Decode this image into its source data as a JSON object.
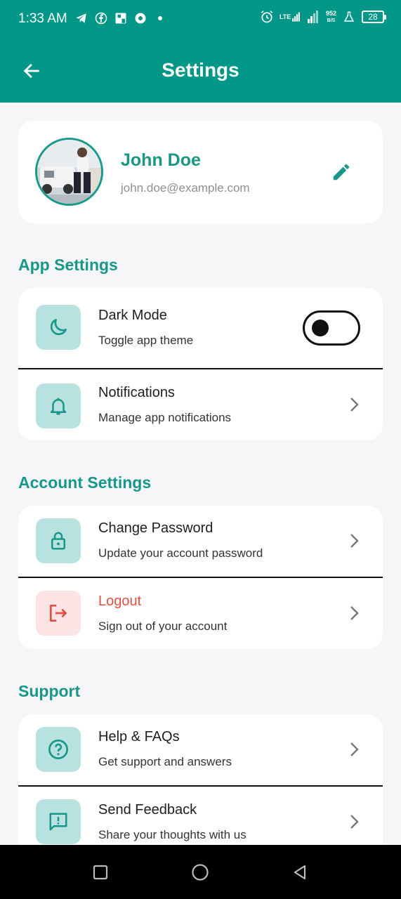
{
  "status_bar": {
    "time": "1:33 AM",
    "net_speed_value": "952",
    "net_speed_unit": "B/S",
    "network_type": "LTE",
    "battery": "28",
    "icons": [
      "telegram-icon",
      "facebook-icon",
      "facebook-page-icon",
      "chrome-icon",
      "dot-icon",
      "alarm-icon",
      "signal-icon",
      "signal-icon",
      "flask-icon",
      "battery-icon"
    ]
  },
  "app_bar": {
    "title": "Settings",
    "back_icon": "arrow-left-icon"
  },
  "profile": {
    "name": "John Doe",
    "email": "john.doe@example.com",
    "edit_icon": "pencil-icon"
  },
  "sections": {
    "app": {
      "title": "App Settings",
      "items": [
        {
          "title": "Dark Mode",
          "subtitle": "Toggle app theme",
          "icon": "moon-icon",
          "control": "toggle",
          "toggle_on": false
        },
        {
          "title": "Notifications",
          "subtitle": "Manage app notifications",
          "icon": "bell-icon",
          "control": "chevron"
        }
      ]
    },
    "account": {
      "title": "Account Settings",
      "items": [
        {
          "title": "Change Password",
          "subtitle": "Update your account password",
          "icon": "lock-icon",
          "control": "chevron"
        },
        {
          "title": "Logout",
          "subtitle": "Sign out of your account",
          "icon": "logout-icon",
          "control": "chevron"
        }
      ]
    },
    "support": {
      "title": "Support",
      "items": [
        {
          "title": "Help & FAQs",
          "subtitle": "Get support and answers",
          "icon": "help-circle-icon",
          "control": "chevron"
        },
        {
          "title": "Send Feedback",
          "subtitle": "Share your thoughts with us",
          "icon": "feedback-icon",
          "control": "chevron"
        }
      ]
    }
  },
  "colors": {
    "primary": "#009688",
    "accent_text": "#17968a",
    "icon_bg": "#b8e2df",
    "danger": "#e04f44",
    "danger_bg": "#fde4e4",
    "page_bg": "#f6f6f8"
  },
  "nav_bar": {
    "buttons": [
      "square-recents-icon",
      "circle-home-icon",
      "triangle-back-icon"
    ]
  }
}
